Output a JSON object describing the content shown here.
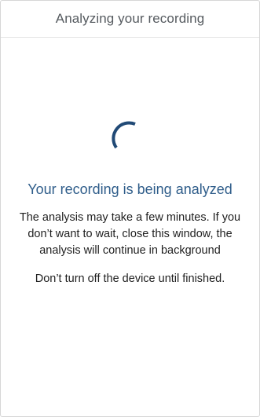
{
  "window": {
    "title": "Analyzing your recording"
  },
  "status": {
    "title": "Your recording is being analyzed",
    "message": "The analysis may take a few minutes. If you don’t want to wait, close this window, the analysis will continue in background",
    "warning": "Don’t turn off the device until finished."
  },
  "icons": {
    "spinner": "loading-spinner-icon"
  },
  "colors": {
    "accent": "#2f5d8a",
    "spinner": "#214a76",
    "header_text": "#555a5f",
    "body_text": "#1f1f1f"
  }
}
